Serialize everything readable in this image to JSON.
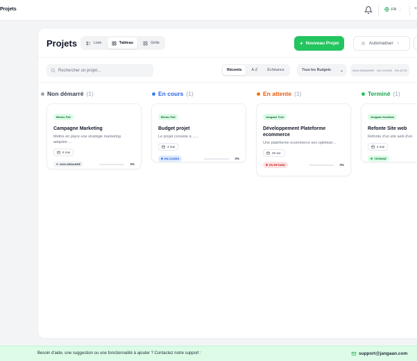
{
  "topbar": {
    "title": "Projets",
    "language": "FR"
  },
  "header": {
    "title": "Projets",
    "view_tabs": [
      {
        "label": "Liste",
        "icon": "list-icon",
        "active": false
      },
      {
        "label": "Tableau",
        "icon": "board-icon",
        "active": true
      },
      {
        "label": "Grille",
        "icon": "grid-icon",
        "active": false
      }
    ],
    "new_project_label": "Nouveau Projet",
    "automate_label": "Automatiser",
    "automate_shortcut": "⇧"
  },
  "filters": {
    "search_placeholder": "Rechercher un projet...",
    "sort_tabs": [
      {
        "label": "Récents",
        "active": true
      },
      {
        "label": "A-Z",
        "active": false
      },
      {
        "label": "Échéance",
        "active": false
      }
    ],
    "budget_select": "Tous les Budgets",
    "status_chips": [
      "NON DÉMARRÉ",
      "EN COURS",
      "EN ATTE"
    ]
  },
  "columns": [
    {
      "title": "Non démarré",
      "count": "(1)",
      "color": "#9ca3af",
      "title_color": "#374151",
      "cards": [
        {
          "owner": "Bintou Fall",
          "title": "Campagne Marketing",
          "description": "Mettre en place une stratégie marketing adaptée ...",
          "date": "6 mai",
          "status": "NON DÉMARRÉ",
          "status_bg": "#f3f4f6",
          "status_fg": "#374151",
          "status_dot": "#9ca3af",
          "progress": "0%"
        }
      ]
    },
    {
      "title": "En cours",
      "count": "(1)",
      "color": "#3b82f6",
      "title_color": "#2563eb",
      "cards": [
        {
          "owner": "Bintou Fall",
          "title": "Budget projet",
          "description": "Le projet consiste à ......",
          "date": "3 mai",
          "status": "EN COURS",
          "status_bg": "#dbeafe",
          "status_fg": "#1d4ed8",
          "status_dot": "#3b82f6",
          "progress": "0%"
        }
      ]
    },
    {
      "title": "En attente",
      "count": "(1)",
      "color": "#f97316",
      "title_color": "#ea580c",
      "cards": [
        {
          "owner": "Jangaan Tech",
          "title": "Développement Plateforme ecommerce",
          "description": "Une plateforme ecommerce seo optimisé...",
          "date": "26 avr.",
          "status": "EN RETARD",
          "status_bg": "#fee2e2",
          "status_fg": "#b91c1c",
          "status_dot": "#ef4444",
          "progress": "0%"
        }
      ]
    },
    {
      "title": "Terminé",
      "count": "(1)",
      "color": "#22c55e",
      "title_color": "#16a34a",
      "cards": [
        {
          "owner": "Jangaan Kamitam",
          "title": "Refonte Site web",
          "description": "Refonte d'un site web d'en",
          "date": "2 mai",
          "status": "TERMINÉ",
          "status_bg": "#dcfce7",
          "status_fg": "#15803d",
          "status_dot": "#22c55e",
          "progress": ""
        }
      ]
    }
  ],
  "footer": {
    "message": "Besoin d'aide, une suggestion ou une fonctionnalité à ajouter ? Contactez notre support :",
    "email": "support@jangaan.com"
  }
}
